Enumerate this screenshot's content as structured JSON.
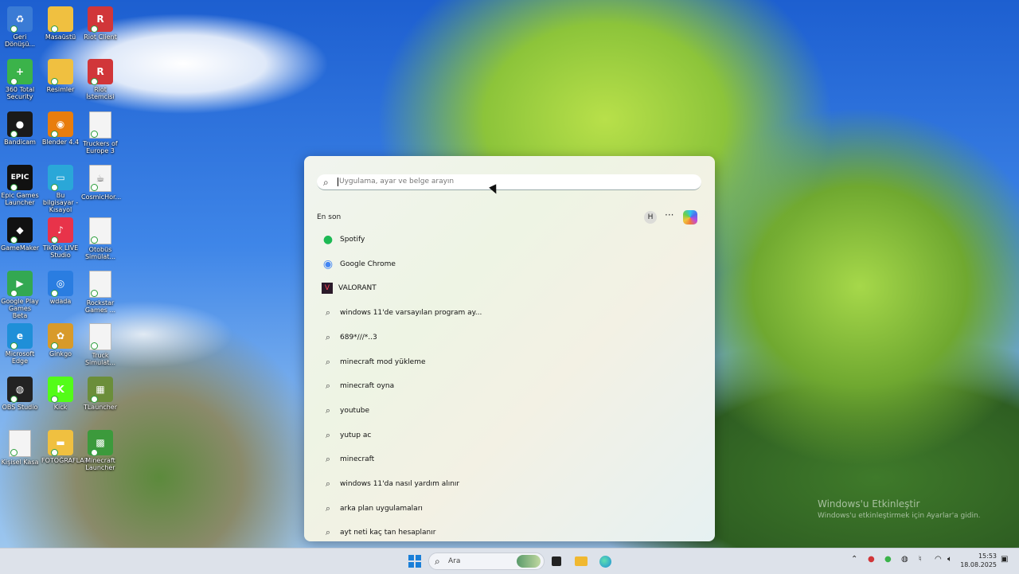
{
  "desktop": {
    "icons": [
      {
        "label": "Geri Dönüşü...",
        "color": "#3a7bd5",
        "glyph": "♻"
      },
      {
        "label": "Masaüstü",
        "color": "#f0c040",
        "glyph": ""
      },
      {
        "label": "Riot Client",
        "color": "#d13639",
        "glyph": "R"
      },
      {
        "label": "360 Total Security",
        "color": "#3bb34a",
        "glyph": "+"
      },
      {
        "label": "Resimler",
        "color": "#f0c040",
        "glyph": ""
      },
      {
        "label": "Riot İstemcisi",
        "color": "#d13639",
        "glyph": "R"
      },
      {
        "label": "Bandicam",
        "color": "#1a1a1a",
        "glyph": "●"
      },
      {
        "label": "Blender 4.4",
        "color": "#e87d0d",
        "glyph": "◉"
      },
      {
        "label": "Truckers of Europe 3",
        "color": "#f4f4f4",
        "glyph": ""
      },
      {
        "label": "Epic Games Launcher",
        "color": "#111111",
        "glyph": "EPIC"
      },
      {
        "label": "Bu bilgisayar - Kısayol",
        "color": "#2aa7d8",
        "glyph": "▭"
      },
      {
        "label": "CosmicHor...",
        "color": "#f4f4f4",
        "glyph": "☕"
      },
      {
        "label": "GameMaker",
        "color": "#111111",
        "glyph": "◆"
      },
      {
        "label": "TikTok LIVE Studio",
        "color": "#e8334a",
        "glyph": "♪"
      },
      {
        "label": "Otobüs Simülat...",
        "color": "#f4f4f4",
        "glyph": ""
      },
      {
        "label": "Google Play Games Beta",
        "color": "#33a852",
        "glyph": "▶"
      },
      {
        "label": "wdada",
        "color": "#2a7de1",
        "glyph": "◎"
      },
      {
        "label": "Rockstar Games ...",
        "color": "#f4f4f4",
        "glyph": ""
      },
      {
        "label": "Microsoft Edge",
        "color": "#1f8fd8",
        "glyph": "e"
      },
      {
        "label": "Ginkgo",
        "color": "#d89a2a",
        "glyph": "✿"
      },
      {
        "label": "Truck Simulat...",
        "color": "#f4f4f4",
        "glyph": ""
      },
      {
        "label": "OBS Studio",
        "color": "#222222",
        "glyph": "◍"
      },
      {
        "label": "Kick",
        "color": "#53fc18",
        "glyph": "K"
      },
      {
        "label": "TLauncher",
        "color": "#6b8e3a",
        "glyph": "▦"
      },
      {
        "label": "Kişisel Kasa",
        "color": "#f4f4f4",
        "glyph": ""
      },
      {
        "label": "FOTOĞRAFLAR",
        "color": "#f0c040",
        "glyph": "▬"
      },
      {
        "label": "Minecraft Launcher",
        "color": "#3c9a3c",
        "glyph": "▩"
      }
    ]
  },
  "start_menu": {
    "search_placeholder": "Uygulama, ayar ve belge arayın",
    "section_title": "En son",
    "badge_letter": "H",
    "more_glyph": "···",
    "items": [
      {
        "label": "Spotify",
        "icon": "spotify-icon",
        "glyph": "●",
        "color": "#1db954"
      },
      {
        "label": "Google Chrome",
        "icon": "chrome-icon",
        "glyph": "◉",
        "color": "#4285f4"
      },
      {
        "label": "VALORANT",
        "icon": "valorant-icon",
        "glyph": "V",
        "color": "#ff4655"
      },
      {
        "label": "windows 11'de varsayılan program ay...",
        "icon": "search-icon",
        "glyph": "⌕",
        "color": "#444444"
      },
      {
        "label": "689*///*..3",
        "icon": "search-icon",
        "glyph": "⌕",
        "color": "#444444"
      },
      {
        "label": "minecraft mod yükleme",
        "icon": "search-icon",
        "glyph": "⌕",
        "color": "#444444"
      },
      {
        "label": "minecraft oyna",
        "icon": "search-icon",
        "glyph": "⌕",
        "color": "#444444"
      },
      {
        "label": "youtube",
        "icon": "search-icon",
        "glyph": "⌕",
        "color": "#444444"
      },
      {
        "label": "yutup ac",
        "icon": "search-icon",
        "glyph": "⌕",
        "color": "#444444"
      },
      {
        "label": "minecraft",
        "icon": "search-icon",
        "glyph": "⌕",
        "color": "#444444"
      },
      {
        "label": "windows 11'da nasıl yardım alınır",
        "icon": "search-icon",
        "glyph": "⌕",
        "color": "#444444"
      },
      {
        "label": "arka plan uygulamaları",
        "icon": "search-icon",
        "glyph": "⌕",
        "color": "#444444"
      },
      {
        "label": "ayt neti kaç tan hesaplanır",
        "icon": "search-icon",
        "glyph": "⌕",
        "color": "#444444"
      }
    ]
  },
  "taskbar": {
    "search_placeholder": "Ara",
    "time": "15:53",
    "date": "18.08.2025"
  },
  "watermark": {
    "title": "Windows'u Etkinleştir",
    "subtitle": "Windows'u etkinleştirmek için Ayarlar'a gidin."
  }
}
